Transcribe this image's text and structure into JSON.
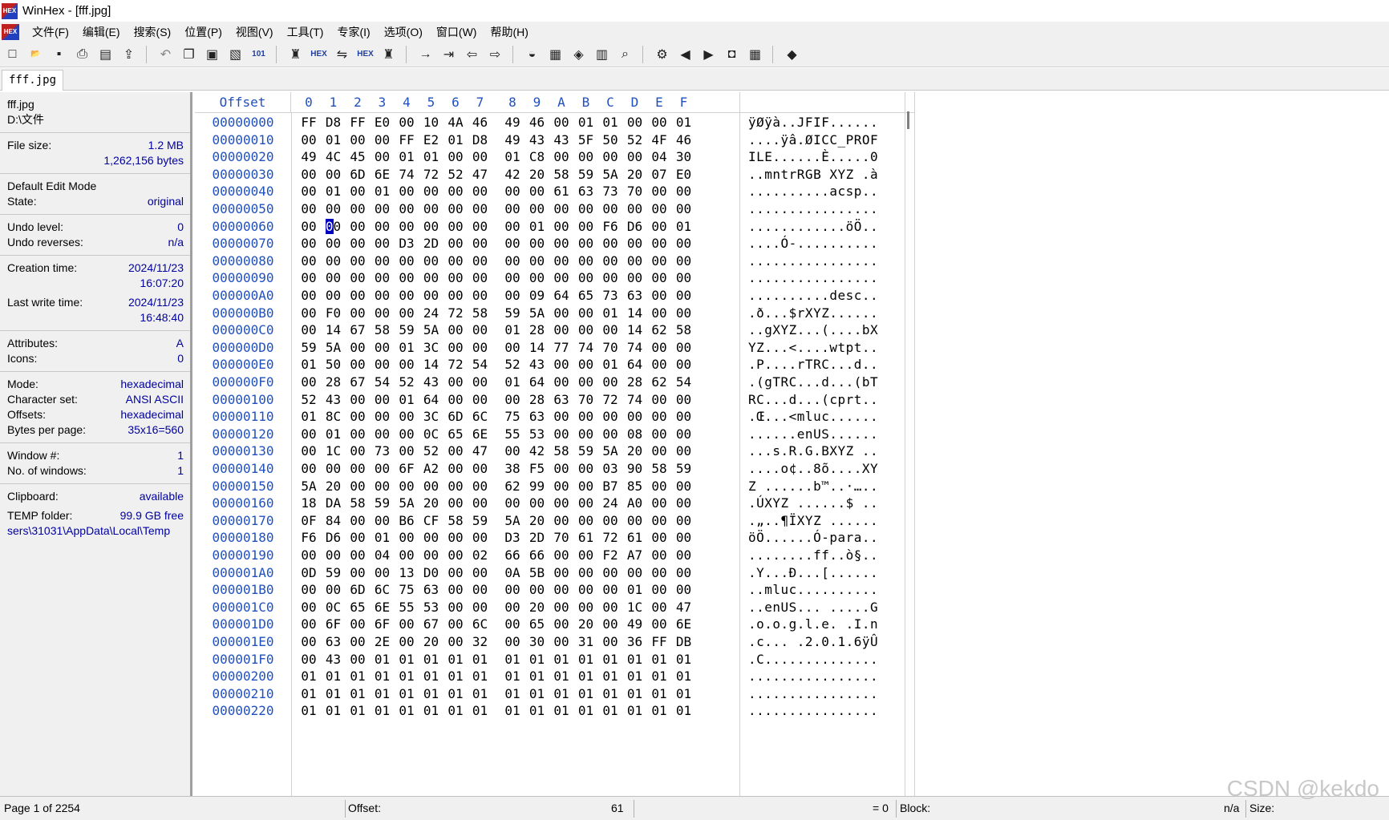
{
  "window": {
    "title": "WinHex - [fff.jpg]",
    "logo_text": "HEX"
  },
  "menu": [
    "文件(F)",
    "编辑(E)",
    "搜索(S)",
    "位置(P)",
    "视图(V)",
    "工具(T)",
    "专家(I)",
    "选项(O)",
    "窗口(W)",
    "帮助(H)"
  ],
  "toolbar": {
    "groups": [
      [
        "new-file-icon",
        "open-file-icon",
        "save-icon",
        "print-icon",
        "properties-icon",
        "open-folder-icon"
      ],
      [
        "undo-icon",
        "copy-icon",
        "paste-icon",
        "paste-write-icon",
        "binary-icon"
      ],
      [
        "find-text-icon",
        "find-hex-icon",
        "replace-text-icon",
        "replace-hex-icon",
        "find-next-icon"
      ],
      [
        "goto-offset-icon",
        "goto-position-icon",
        "back-icon",
        "forward-icon"
      ],
      [
        "disk-icon",
        "ram-icon",
        "edit-disk-icon",
        "calculator-icon",
        "search-icon"
      ],
      [
        "tools-icon",
        "prev-icon",
        "next-icon",
        "snapshot-icon",
        "table-icon"
      ],
      [
        "help-book-icon"
      ]
    ],
    "glyphs": {
      "new-file-icon": "□",
      "open-file-icon": "📂",
      "save-icon": "▪",
      "print-icon": "⎙",
      "properties-icon": "▤",
      "open-folder-icon": "⇪",
      "undo-icon": "↶",
      "copy-icon": "❐",
      "paste-icon": "▣",
      "paste-write-icon": "▧",
      "binary-icon": "101",
      "find-text-icon": "♜",
      "find-hex-icon": "HEX",
      "replace-text-icon": "⇋",
      "replace-hex-icon": "HEX",
      "find-next-icon": "♜",
      "goto-offset-icon": "→",
      "goto-position-icon": "⇥",
      "back-icon": "⇦",
      "forward-icon": "⇨",
      "disk-icon": "◒",
      "ram-icon": "▦",
      "edit-disk-icon": "◈",
      "calculator-icon": "▥",
      "search-icon": "⌕",
      "tools-icon": "⚙",
      "prev-icon": "◀",
      "next-icon": "▶",
      "snapshot-icon": "◘",
      "table-icon": "▦",
      "help-book-icon": "◆"
    }
  },
  "tab": {
    "label": "fff.jpg"
  },
  "info": {
    "filename": "fff.jpg",
    "path": "D:\\文件",
    "file_size_label": "File size:",
    "file_size_value": "1.2 MB",
    "file_size_bytes": "1,262,156 bytes",
    "edit_mode": "Default Edit Mode",
    "state_label": "State:",
    "state_value": "original",
    "undo_level_label": "Undo level:",
    "undo_level_value": "0",
    "undo_reverses_label": "Undo reverses:",
    "undo_reverses_value": "n/a",
    "creation_label": "Creation time:",
    "creation_date": "2024/11/23",
    "creation_time": "16:07:20",
    "lastwrite_label": "Last write time:",
    "lastwrite_date": "2024/11/23",
    "lastwrite_time": "16:48:40",
    "attributes_label": "Attributes:",
    "attributes_value": "A",
    "icons_label": "Icons:",
    "icons_value": "0",
    "mode_label": "Mode:",
    "mode_value": "hexadecimal",
    "charset_label": "Character set:",
    "charset_value": "ANSI ASCII",
    "offsets_label": "Offsets:",
    "offsets_value": "hexadecimal",
    "bpp_label": "Bytes per page:",
    "bpp_value": "35x16=560",
    "window_label": "Window #:",
    "window_value": "1",
    "nwin_label": "No. of windows:",
    "nwin_value": "1",
    "clipboard_label": "Clipboard:",
    "clipboard_value": "available",
    "temp_label": "TEMP folder:",
    "temp_value": "99.9 GB free",
    "temp_path": "sers\\31031\\AppData\\Local\\Temp"
  },
  "hex": {
    "header_offset": "Offset",
    "columns": [
      "0",
      "1",
      "2",
      "3",
      "4",
      "5",
      "6",
      "7",
      "8",
      "9",
      "A",
      "B",
      "C",
      "D",
      "E",
      "F"
    ],
    "cursor": {
      "row": 6,
      "col": 1
    },
    "rows": [
      {
        "offset": "00000000",
        "bytes": [
          "FF",
          "D8",
          "FF",
          "E0",
          "00",
          "10",
          "4A",
          "46",
          "49",
          "46",
          "00",
          "01",
          "01",
          "00",
          "00",
          "01"
        ],
        "ascii": "ÿØÿà..JFIF......"
      },
      {
        "offset": "00000010",
        "bytes": [
          "00",
          "01",
          "00",
          "00",
          "FF",
          "E2",
          "01",
          "D8",
          "49",
          "43",
          "43",
          "5F",
          "50",
          "52",
          "4F",
          "46"
        ],
        "ascii": "....ÿâ.ØICC_PROF"
      },
      {
        "offset": "00000020",
        "bytes": [
          "49",
          "4C",
          "45",
          "00",
          "01",
          "01",
          "00",
          "00",
          "01",
          "C8",
          "00",
          "00",
          "00",
          "00",
          "04",
          "30"
        ],
        "ascii": "ILE......È.....0"
      },
      {
        "offset": "00000030",
        "bytes": [
          "00",
          "00",
          "6D",
          "6E",
          "74",
          "72",
          "52",
          "47",
          "42",
          "20",
          "58",
          "59",
          "5A",
          "20",
          "07",
          "E0"
        ],
        "ascii": "..mntrRGB XYZ .à"
      },
      {
        "offset": "00000040",
        "bytes": [
          "00",
          "01",
          "00",
          "01",
          "00",
          "00",
          "00",
          "00",
          "00",
          "00",
          "61",
          "63",
          "73",
          "70",
          "00",
          "00"
        ],
        "ascii": "..........acsp.."
      },
      {
        "offset": "00000050",
        "bytes": [
          "00",
          "00",
          "00",
          "00",
          "00",
          "00",
          "00",
          "00",
          "00",
          "00",
          "00",
          "00",
          "00",
          "00",
          "00",
          "00"
        ],
        "ascii": "................"
      },
      {
        "offset": "00000060",
        "bytes": [
          "00",
          "00",
          "00",
          "00",
          "00",
          "00",
          "00",
          "00",
          "00",
          "01",
          "00",
          "00",
          "F6",
          "D6",
          "00",
          "01"
        ],
        "ascii": "............öÖ.."
      },
      {
        "offset": "00000070",
        "bytes": [
          "00",
          "00",
          "00",
          "00",
          "D3",
          "2D",
          "00",
          "00",
          "00",
          "00",
          "00",
          "00",
          "00",
          "00",
          "00",
          "00"
        ],
        "ascii": "....Ó-.........."
      },
      {
        "offset": "00000080",
        "bytes": [
          "00",
          "00",
          "00",
          "00",
          "00",
          "00",
          "00",
          "00",
          "00",
          "00",
          "00",
          "00",
          "00",
          "00",
          "00",
          "00"
        ],
        "ascii": "................"
      },
      {
        "offset": "00000090",
        "bytes": [
          "00",
          "00",
          "00",
          "00",
          "00",
          "00",
          "00",
          "00",
          "00",
          "00",
          "00",
          "00",
          "00",
          "00",
          "00",
          "00"
        ],
        "ascii": "................"
      },
      {
        "offset": "000000A0",
        "bytes": [
          "00",
          "00",
          "00",
          "00",
          "00",
          "00",
          "00",
          "00",
          "00",
          "09",
          "64",
          "65",
          "73",
          "63",
          "00",
          "00"
        ],
        "ascii": "..........desc.."
      },
      {
        "offset": "000000B0",
        "bytes": [
          "00",
          "F0",
          "00",
          "00",
          "00",
          "24",
          "72",
          "58",
          "59",
          "5A",
          "00",
          "00",
          "01",
          "14",
          "00",
          "00"
        ],
        "ascii": ".ð...$rXYZ......"
      },
      {
        "offset": "000000C0",
        "bytes": [
          "00",
          "14",
          "67",
          "58",
          "59",
          "5A",
          "00",
          "00",
          "01",
          "28",
          "00",
          "00",
          "00",
          "14",
          "62",
          "58"
        ],
        "ascii": "..gXYZ...(....bX"
      },
      {
        "offset": "000000D0",
        "bytes": [
          "59",
          "5A",
          "00",
          "00",
          "01",
          "3C",
          "00",
          "00",
          "00",
          "14",
          "77",
          "74",
          "70",
          "74",
          "00",
          "00"
        ],
        "ascii": "YZ...<....wtpt.."
      },
      {
        "offset": "000000E0",
        "bytes": [
          "01",
          "50",
          "00",
          "00",
          "00",
          "14",
          "72",
          "54",
          "52",
          "43",
          "00",
          "00",
          "01",
          "64",
          "00",
          "00"
        ],
        "ascii": ".P....rTRC...d.."
      },
      {
        "offset": "000000F0",
        "bytes": [
          "00",
          "28",
          "67",
          "54",
          "52",
          "43",
          "00",
          "00",
          "01",
          "64",
          "00",
          "00",
          "00",
          "28",
          "62",
          "54"
        ],
        "ascii": ".(gTRC...d...(bT"
      },
      {
        "offset": "00000100",
        "bytes": [
          "52",
          "43",
          "00",
          "00",
          "01",
          "64",
          "00",
          "00",
          "00",
          "28",
          "63",
          "70",
          "72",
          "74",
          "00",
          "00"
        ],
        "ascii": "RC...d...(cprt.."
      },
      {
        "offset": "00000110",
        "bytes": [
          "01",
          "8C",
          "00",
          "00",
          "00",
          "3C",
          "6D",
          "6C",
          "75",
          "63",
          "00",
          "00",
          "00",
          "00",
          "00",
          "00"
        ],
        "ascii": ".Œ...<mluc......"
      },
      {
        "offset": "00000120",
        "bytes": [
          "00",
          "01",
          "00",
          "00",
          "00",
          "0C",
          "65",
          "6E",
          "55",
          "53",
          "00",
          "00",
          "00",
          "08",
          "00",
          "00"
        ],
        "ascii": "......enUS......"
      },
      {
        "offset": "00000130",
        "bytes": [
          "00",
          "1C",
          "00",
          "73",
          "00",
          "52",
          "00",
          "47",
          "00",
          "42",
          "58",
          "59",
          "5A",
          "20",
          "00",
          "00"
        ],
        "ascii": "...s.R.G.BXYZ .."
      },
      {
        "offset": "00000140",
        "bytes": [
          "00",
          "00",
          "00",
          "00",
          "6F",
          "A2",
          "00",
          "00",
          "38",
          "F5",
          "00",
          "00",
          "03",
          "90",
          "58",
          "59"
        ],
        "ascii": "....o¢..8õ....XY"
      },
      {
        "offset": "00000150",
        "bytes": [
          "5A",
          "20",
          "00",
          "00",
          "00",
          "00",
          "00",
          "00",
          "62",
          "99",
          "00",
          "00",
          "B7",
          "85",
          "00",
          "00"
        ],
        "ascii": "Z ......b™..·….."
      },
      {
        "offset": "00000160",
        "bytes": [
          "18",
          "DA",
          "58",
          "59",
          "5A",
          "20",
          "00",
          "00",
          "00",
          "00",
          "00",
          "00",
          "24",
          "A0",
          "00",
          "00"
        ],
        "ascii": ".ÚXYZ ......$ .."
      },
      {
        "offset": "00000170",
        "bytes": [
          "0F",
          "84",
          "00",
          "00",
          "B6",
          "CF",
          "58",
          "59",
          "5A",
          "20",
          "00",
          "00",
          "00",
          "00",
          "00",
          "00"
        ],
        "ascii": ".„..¶ÏXYZ ......"
      },
      {
        "offset": "00000180",
        "bytes": [
          "F6",
          "D6",
          "00",
          "01",
          "00",
          "00",
          "00",
          "00",
          "D3",
          "2D",
          "70",
          "61",
          "72",
          "61",
          "00",
          "00"
        ],
        "ascii": "öÖ......Ó-para.."
      },
      {
        "offset": "00000190",
        "bytes": [
          "00",
          "00",
          "00",
          "04",
          "00",
          "00",
          "00",
          "02",
          "66",
          "66",
          "00",
          "00",
          "F2",
          "A7",
          "00",
          "00"
        ],
        "ascii": "........ff..ò§.."
      },
      {
        "offset": "000001A0",
        "bytes": [
          "0D",
          "59",
          "00",
          "00",
          "13",
          "D0",
          "00",
          "00",
          "0A",
          "5B",
          "00",
          "00",
          "00",
          "00",
          "00",
          "00"
        ],
        "ascii": ".Y...Ð...[......"
      },
      {
        "offset": "000001B0",
        "bytes": [
          "00",
          "00",
          "6D",
          "6C",
          "75",
          "63",
          "00",
          "00",
          "00",
          "00",
          "00",
          "00",
          "00",
          "01",
          "00",
          "00"
        ],
        "ascii": "..mluc.........."
      },
      {
        "offset": "000001C0",
        "bytes": [
          "00",
          "0C",
          "65",
          "6E",
          "55",
          "53",
          "00",
          "00",
          "00",
          "20",
          "00",
          "00",
          "00",
          "1C",
          "00",
          "47"
        ],
        "ascii": "..enUS... .....G"
      },
      {
        "offset": "000001D0",
        "bytes": [
          "00",
          "6F",
          "00",
          "6F",
          "00",
          "67",
          "00",
          "6C",
          "00",
          "65",
          "00",
          "20",
          "00",
          "49",
          "00",
          "6E"
        ],
        "ascii": ".o.o.g.l.e. .I.n"
      },
      {
        "offset": "000001E0",
        "bytes": [
          "00",
          "63",
          "00",
          "2E",
          "00",
          "20",
          "00",
          "32",
          "00",
          "30",
          "00",
          "31",
          "00",
          "36",
          "FF",
          "DB"
        ],
        "ascii": ".c... .2.0.1.6ÿÛ"
      },
      {
        "offset": "000001F0",
        "bytes": [
          "00",
          "43",
          "00",
          "01",
          "01",
          "01",
          "01",
          "01",
          "01",
          "01",
          "01",
          "01",
          "01",
          "01",
          "01",
          "01"
        ],
        "ascii": ".C.............."
      },
      {
        "offset": "00000200",
        "bytes": [
          "01",
          "01",
          "01",
          "01",
          "01",
          "01",
          "01",
          "01",
          "01",
          "01",
          "01",
          "01",
          "01",
          "01",
          "01",
          "01"
        ],
        "ascii": "................"
      },
      {
        "offset": "00000210",
        "bytes": [
          "01",
          "01",
          "01",
          "01",
          "01",
          "01",
          "01",
          "01",
          "01",
          "01",
          "01",
          "01",
          "01",
          "01",
          "01",
          "01"
        ],
        "ascii": "................"
      },
      {
        "offset": "00000220",
        "bytes": [
          "01",
          "01",
          "01",
          "01",
          "01",
          "01",
          "01",
          "01",
          "01",
          "01",
          "01",
          "01",
          "01",
          "01",
          "01",
          "01"
        ],
        "ascii": "................"
      }
    ]
  },
  "status": {
    "page": "Page 1 of 2254",
    "offset_label": "Offset:",
    "offset_value": "61",
    "eq_value": "= 0",
    "block_label": "Block:",
    "na_value": "n/a",
    "size_label": "Size:"
  },
  "watermark": "CSDN @kekdo"
}
